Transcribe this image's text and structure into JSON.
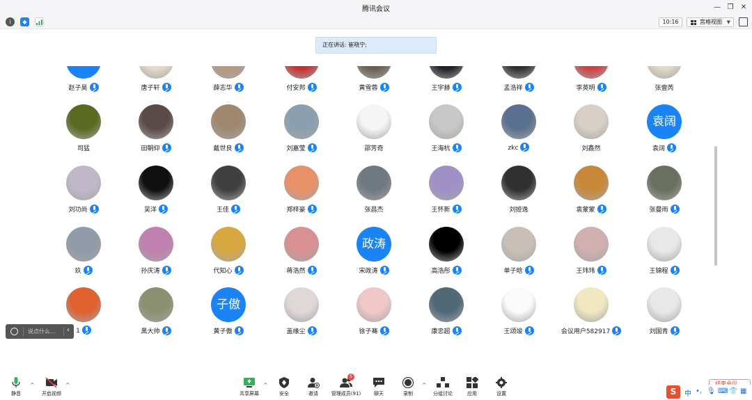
{
  "window": {
    "title": "腾讯会议"
  },
  "topbar": {
    "time": "10:16",
    "view_label": "宫格视图"
  },
  "speaker_banner": "正在讲话: 崔晓宁;",
  "participants": [
    [
      {
        "name": "赵子昊",
        "avatar": "text",
        "avatar_text": "",
        "color": "#1a84f6",
        "mic": true
      },
      {
        "name": "唐子轩",
        "avatar": "photo",
        "color": "#e8d8c8",
        "mic": true
      },
      {
        "name": "薛志华",
        "avatar": "photo",
        "color": "#b89880",
        "mic": true
      },
      {
        "name": "付安邦",
        "avatar": "photo",
        "color": "#c83030",
        "mic": true
      },
      {
        "name": "黄雪蓉",
        "avatar": "photo",
        "color": "#6a6050",
        "mic": true
      },
      {
        "name": "王宇赫",
        "avatar": "photo",
        "color": "#202028",
        "mic": true
      },
      {
        "name": "孟浩祥",
        "avatar": "photo",
        "color": "#303030",
        "mic": true
      },
      {
        "name": "李英明",
        "avatar": "photo",
        "color": "#d04040",
        "mic": true
      },
      {
        "name": "张壹芮",
        "avatar": "photo",
        "color": "#e0d8c8",
        "mic": false
      }
    ],
    [
      {
        "name": "司猛",
        "avatar": "photo",
        "color": "#5a6a20",
        "mic": false
      },
      {
        "name": "田朝仰",
        "avatar": "photo",
        "color": "#5a4a48",
        "mic": true
      },
      {
        "name": "戴世良",
        "avatar": "photo",
        "color": "#a08870",
        "mic": true
      },
      {
        "name": "刘嘉莹",
        "avatar": "photo",
        "color": "#8aa0b0",
        "mic": true
      },
      {
        "name": "邵芳奇",
        "avatar": "photo",
        "color": "#f5f5f5",
        "mic": false
      },
      {
        "name": "王海杭",
        "avatar": "photo",
        "color": "#c8c8c8",
        "mic": true
      },
      {
        "name": "zkc",
        "avatar": "photo",
        "color": "#5a7090",
        "mic": true
      },
      {
        "name": "刘鑫然",
        "avatar": "photo",
        "color": "#d8d0c8",
        "mic": false
      },
      {
        "name": "袁阔",
        "avatar": "text",
        "avatar_text": "袁阔",
        "color": "#1a84f6",
        "mic": true
      }
    ],
    [
      {
        "name": "刘功尚",
        "avatar": "photo",
        "color": "#c0b8c8",
        "mic": true
      },
      {
        "name": "吴洋",
        "avatar": "photo",
        "color": "#101010",
        "mic": true
      },
      {
        "name": "王佳",
        "avatar": "photo",
        "color": "#404040",
        "mic": true
      },
      {
        "name": "郑梓豪",
        "avatar": "photo",
        "color": "#e89068",
        "mic": true
      },
      {
        "name": "张昌杰",
        "avatar": "photo",
        "color": "#707880",
        "mic": false
      },
      {
        "name": "王怀新",
        "avatar": "photo",
        "color": "#a090c8",
        "mic": true
      },
      {
        "name": "刘娅逸",
        "avatar": "photo",
        "color": "#303030",
        "mic": false
      },
      {
        "name": "袁蒙蒙",
        "avatar": "photo",
        "color": "#c8883a",
        "mic": true
      },
      {
        "name": "张曼雨",
        "avatar": "photo",
        "color": "#6a7060",
        "mic": true
      }
    ],
    [
      {
        "name": "玖",
        "avatar": "photo",
        "color": "#909aa8",
        "mic": true
      },
      {
        "name": "孙庆涛",
        "avatar": "photo",
        "color": "#c080b0",
        "mic": true
      },
      {
        "name": "代知心",
        "avatar": "photo",
        "color": "#d8a840",
        "mic": true
      },
      {
        "name": "蒋浩然",
        "avatar": "photo",
        "color": "#d89090",
        "mic": true
      },
      {
        "name": "宋政涛",
        "avatar": "text",
        "avatar_text": "政涛",
        "color": "#1a84f6",
        "mic": true
      },
      {
        "name": "高浩彤",
        "avatar": "photo",
        "color": "#000000",
        "mic": true
      },
      {
        "name": "单子晗",
        "avatar": "photo",
        "color": "#c8c0b8",
        "mic": true
      },
      {
        "name": "王玮玮",
        "avatar": "photo",
        "color": "#d0b0b0",
        "mic": true
      },
      {
        "name": "王锦程",
        "avatar": "photo",
        "color": "#e8e8e8",
        "mic": true
      }
    ],
    [
      {
        "name": "1",
        "avatar": "photo",
        "color": "#e06030",
        "mic": true
      },
      {
        "name": "黑大帅",
        "avatar": "photo",
        "color": "#8a9070",
        "mic": true
      },
      {
        "name": "黄子傲",
        "avatar": "text",
        "avatar_text": "子傲",
        "color": "#1a84f6",
        "mic": true
      },
      {
        "name": "盖缘尘",
        "avatar": "photo",
        "color": "#e0d8d8",
        "mic": true
      },
      {
        "name": "徐子骞",
        "avatar": "photo",
        "color": "#f0c8c8",
        "mic": true
      },
      {
        "name": "康忠超",
        "avatar": "photo",
        "color": "#506878",
        "mic": true
      },
      {
        "name": "王颂竣",
        "avatar": "photo",
        "color": "#fafafa",
        "mic": true
      },
      {
        "name": "会议用户582917",
        "avatar": "photo",
        "color": "#f0e8c0",
        "mic": true
      },
      {
        "name": "刘国青",
        "avatar": "photo",
        "color": "#e8e8e8",
        "mic": true
      }
    ]
  ],
  "chat": {
    "placeholder": "说点什么..."
  },
  "toolbar": {
    "mute": "静音",
    "video": "开启视频",
    "share": "共享屏幕",
    "security": "安全",
    "invite": "邀请",
    "members": "管理成员(91)",
    "members_badge": "5",
    "chat": "聊天",
    "record": "录制",
    "breakout": "分组讨论",
    "apps": "应用",
    "settings": "设置",
    "end": "结束会议"
  },
  "ime": {
    "logo": "S",
    "lang": "中"
  }
}
